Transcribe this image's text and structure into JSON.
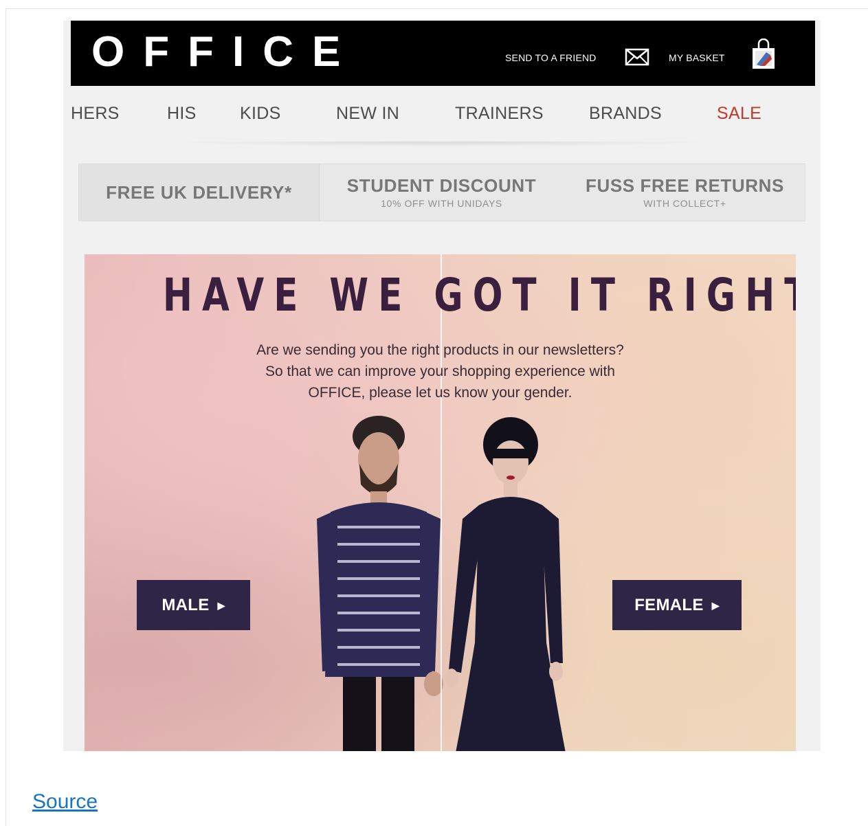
{
  "header": {
    "logo": "OFFICE",
    "send_to_friend": "SEND TO A FRIEND",
    "my_basket": "MY BASKET"
  },
  "nav": {
    "items": [
      {
        "label": "HERS"
      },
      {
        "label": "HIS"
      },
      {
        "label": "KIDS"
      },
      {
        "label": "NEW IN"
      },
      {
        "label": "TRAINERS"
      },
      {
        "label": "BRANDS"
      },
      {
        "label": "SALE"
      }
    ],
    "sale_color": "#c0392b"
  },
  "usp": [
    {
      "title": "FREE UK DELIVERY*",
      "subtitle": ""
    },
    {
      "title": "STUDENT DISCOUNT",
      "subtitle": "10% OFF WITH UNIDAYS"
    },
    {
      "title": "FUSS FREE RETURNS",
      "subtitle": "WITH COLLECT+"
    }
  ],
  "hero": {
    "title": "HAVE WE GOT IT RIGHT?",
    "lines": [
      "Are we sending you the right products in our newsletters?",
      "So that we can improve your shopping experience with",
      "OFFICE, please let us know your gender."
    ],
    "male_button": "MALE",
    "female_button": "FEMALE",
    "button_color": "#2e2547"
  },
  "footer": {
    "source_link": "Source"
  }
}
